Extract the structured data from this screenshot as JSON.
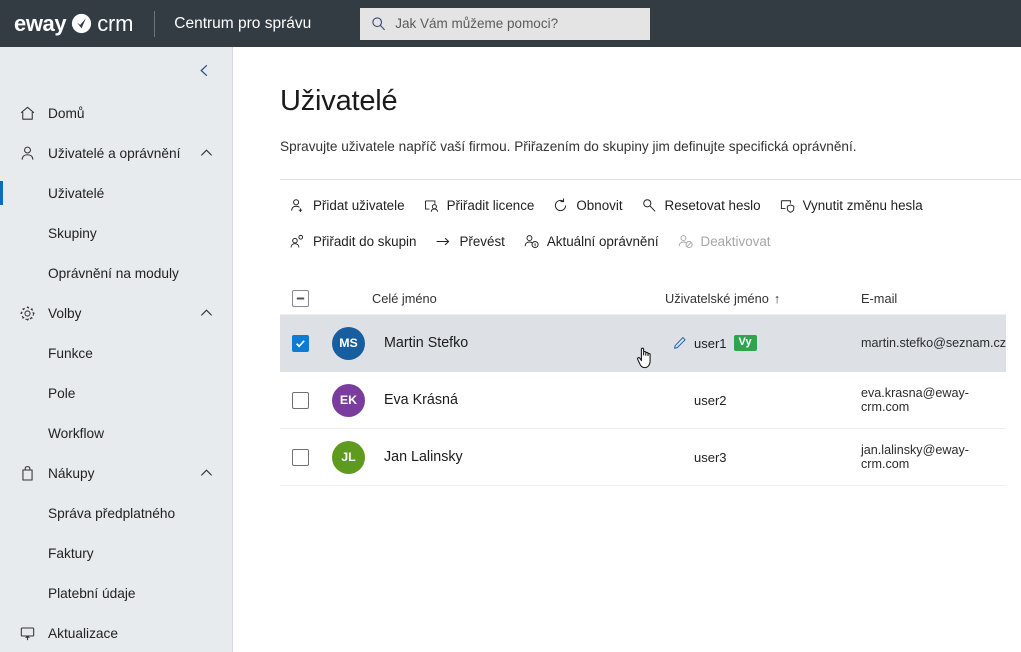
{
  "topbar": {
    "logo_text": "eway",
    "logo_crm": "crm",
    "title": "Centrum pro správu",
    "search_placeholder": "Jak Vám můžeme pomoci?",
    "search_value": ""
  },
  "sidebar": {
    "collapse_label": "chevron-left",
    "items": [
      {
        "label": "Domů",
        "icon": "home-icon",
        "type": "top",
        "expandable": false,
        "active": false
      },
      {
        "label": "Uživatelé a oprávnění",
        "icon": "person-icon",
        "type": "top",
        "expandable": true,
        "active": false
      },
      {
        "label": "Uživatelé",
        "icon": "",
        "type": "sub",
        "expandable": false,
        "active": true
      },
      {
        "label": "Skupiny",
        "icon": "",
        "type": "sub",
        "expandable": false,
        "active": false
      },
      {
        "label": "Oprávnění na moduly",
        "icon": "",
        "type": "sub",
        "expandable": false,
        "active": false
      },
      {
        "label": "Volby",
        "icon": "gear-icon",
        "type": "top",
        "expandable": true,
        "active": false
      },
      {
        "label": "Funkce",
        "icon": "",
        "type": "sub",
        "expandable": false,
        "active": false
      },
      {
        "label": "Pole",
        "icon": "",
        "type": "sub",
        "expandable": false,
        "active": false
      },
      {
        "label": "Workflow",
        "icon": "",
        "type": "sub",
        "expandable": false,
        "active": false
      },
      {
        "label": "Nákupy",
        "icon": "bag-icon",
        "type": "top",
        "expandable": true,
        "active": false
      },
      {
        "label": "Správa předplatného",
        "icon": "",
        "type": "sub",
        "expandable": false,
        "active": false
      },
      {
        "label": "Faktury",
        "icon": "",
        "type": "sub",
        "expandable": false,
        "active": false
      },
      {
        "label": "Platební údaje",
        "icon": "",
        "type": "sub",
        "expandable": false,
        "active": false
      },
      {
        "label": "Aktualizace",
        "icon": "monitor-update-icon",
        "type": "top",
        "expandable": false,
        "active": false
      }
    ]
  },
  "page": {
    "title": "Uživatelé",
    "description": "Spravujte uživatele napříč vaší firmou. Přiřazením do skupiny jim definujte specifická oprávnění."
  },
  "toolbar": {
    "row1": [
      {
        "label": "Přidat uživatele",
        "icon": "person-add-icon",
        "disabled": false
      },
      {
        "label": "Přiřadit licence",
        "icon": "license-assign-icon",
        "disabled": false
      },
      {
        "label": "Obnovit",
        "icon": "refresh-icon",
        "disabled": false
      },
      {
        "label": "Resetovat heslo",
        "icon": "key-icon",
        "disabled": false
      },
      {
        "label": "Vynutit změnu hesla",
        "icon": "shield-password-icon",
        "disabled": false
      }
    ],
    "row2": [
      {
        "label": "Přiřadit do skupin",
        "icon": "person-group-icon",
        "disabled": false
      },
      {
        "label": "Převést",
        "icon": "arrow-right-icon",
        "disabled": false
      },
      {
        "label": "Aktuální oprávnění",
        "icon": "person-info-icon",
        "disabled": false
      },
      {
        "label": "Deaktivovat",
        "icon": "person-block-icon",
        "disabled": true
      }
    ]
  },
  "table": {
    "select_all_state": "indeterminate",
    "columns": {
      "name": "Celé jméno",
      "username": "Uživatelské jméno",
      "email": "E-mail"
    },
    "sort": {
      "column": "username",
      "direction": "asc",
      "glyph": "↑"
    },
    "rows": [
      {
        "selected": true,
        "initials": "MS",
        "avatar_color": "#175e9e",
        "full_name": "Martin Stefko",
        "username": "user1",
        "badge": "Vy",
        "badge_color": "#2ea44f",
        "email": "martin.stefko@seznam.cz",
        "show_edit_icon": true
      },
      {
        "selected": false,
        "initials": "EK",
        "avatar_color": "#7a3d9e",
        "full_name": "Eva Krásná",
        "username": "user2",
        "badge": "",
        "badge_color": "",
        "email": "eva.krasna@eway-crm.com",
        "show_edit_icon": false
      },
      {
        "selected": false,
        "initials": "JL",
        "avatar_color": "#5e9a1e",
        "full_name": "Jan Lalinsky",
        "username": "user3",
        "badge": "",
        "badge_color": "",
        "email": "jan.lalinsky@eway-crm.com",
        "show_edit_icon": false
      }
    ]
  },
  "colors": {
    "topbar_bg": "#333b43",
    "sidebar_bg": "#e8ebee",
    "accent": "#0f6cbd",
    "selected_row": "#dde1e6",
    "checkbox_checked": "#0c7cd5"
  }
}
